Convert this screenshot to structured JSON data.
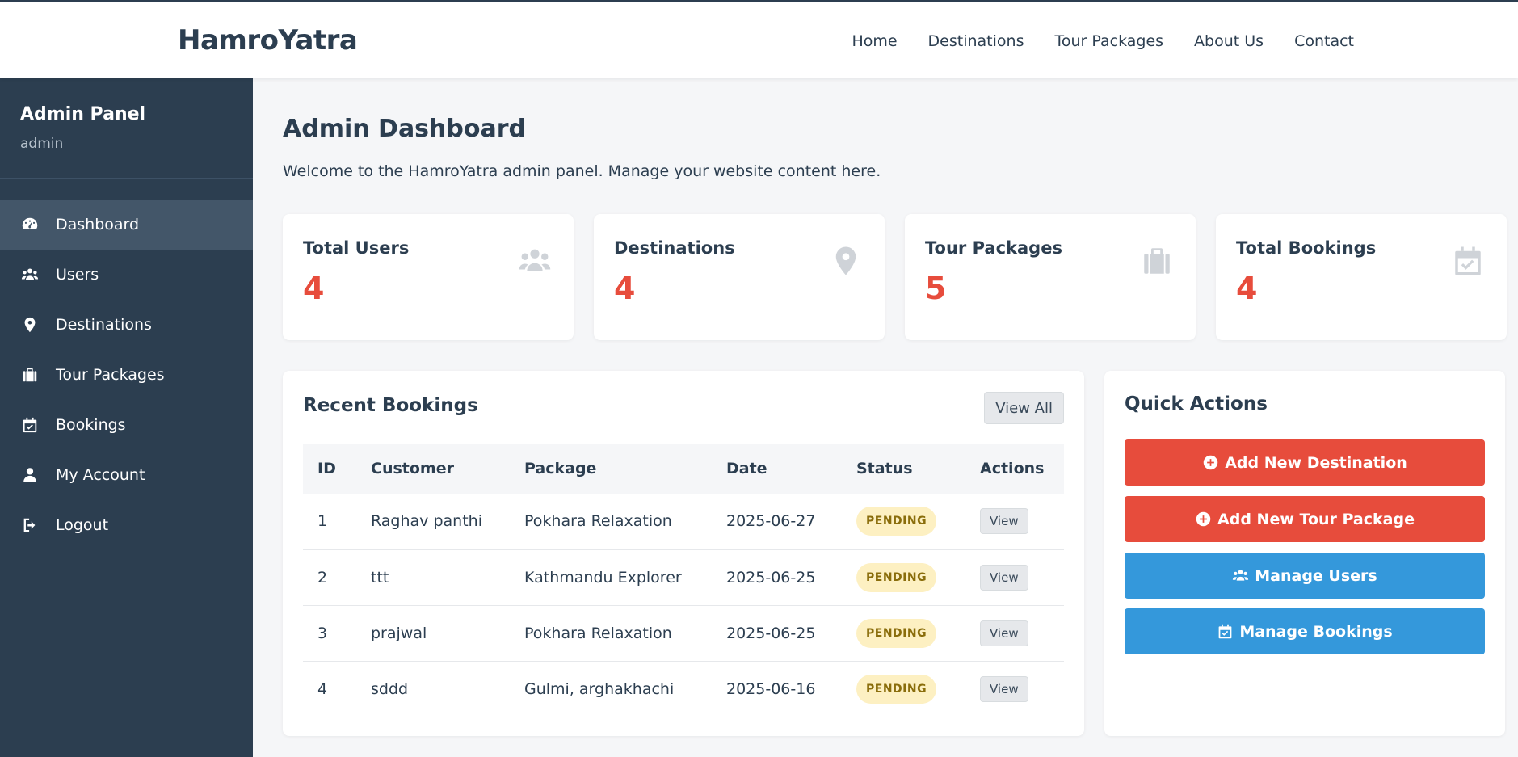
{
  "brand": "HamroYatra",
  "nav": [
    "Home",
    "Destinations",
    "Tour Packages",
    "About Us",
    "Contact"
  ],
  "sidebar": {
    "title": "Admin Panel",
    "user": "admin",
    "items": [
      {
        "label": "Dashboard",
        "icon": "dashboard-icon"
      },
      {
        "label": "Users",
        "icon": "users-icon"
      },
      {
        "label": "Destinations",
        "icon": "map-pin-icon"
      },
      {
        "label": "Tour Packages",
        "icon": "suitcase-icon"
      },
      {
        "label": "Bookings",
        "icon": "calendar-check-icon"
      },
      {
        "label": "My Account",
        "icon": "user-icon"
      },
      {
        "label": "Logout",
        "icon": "logout-icon"
      }
    ]
  },
  "main": {
    "title": "Admin Dashboard",
    "subtitle": "Welcome to the HamroYatra admin panel. Manage your website content here."
  },
  "stats": [
    {
      "label": "Total Users",
      "value": "4",
      "icon": "users-icon"
    },
    {
      "label": "Destinations",
      "value": "4",
      "icon": "map-pin-icon"
    },
    {
      "label": "Tour Packages",
      "value": "5",
      "icon": "suitcase-icon"
    },
    {
      "label": "Total Bookings",
      "value": "4",
      "icon": "calendar-check-icon"
    }
  ],
  "bookings": {
    "title": "Recent Bookings",
    "view_all": "View All",
    "columns": [
      "ID",
      "Customer",
      "Package",
      "Date",
      "Status",
      "Actions"
    ],
    "rows": [
      {
        "id": "1",
        "customer": "Raghav panthi",
        "package": "Pokhara Relaxation",
        "date": "2025-06-27",
        "status": "PENDING",
        "action": "View"
      },
      {
        "id": "2",
        "customer": "ttt",
        "package": "Kathmandu Explorer",
        "date": "2025-06-25",
        "status": "PENDING",
        "action": "View"
      },
      {
        "id": "3",
        "customer": "prajwal",
        "package": "Pokhara Relaxation",
        "date": "2025-06-25",
        "status": "PENDING",
        "action": "View"
      },
      {
        "id": "4",
        "customer": "sddd",
        "package": "Gulmi, arghakhachi",
        "date": "2025-06-16",
        "status": "PENDING",
        "action": "View"
      }
    ]
  },
  "quick": {
    "title": "Quick Actions",
    "buttons": [
      {
        "label": "Add New Destination",
        "icon": "plus-circle-icon",
        "color": "#e74c3c"
      },
      {
        "label": "Add New Tour Package",
        "icon": "plus-circle-icon",
        "color": "#e74c3c"
      },
      {
        "label": "Manage Users",
        "icon": "users-icon",
        "color": "#3498db"
      },
      {
        "label": "Manage Bookings",
        "icon": "calendar-check-icon",
        "color": "#3498db"
      }
    ]
  },
  "colors": {
    "sidebar": "#2c3e50",
    "accent_red": "#e74c3c",
    "accent_blue": "#3498db",
    "badge_pending": "#fdf0c2"
  }
}
